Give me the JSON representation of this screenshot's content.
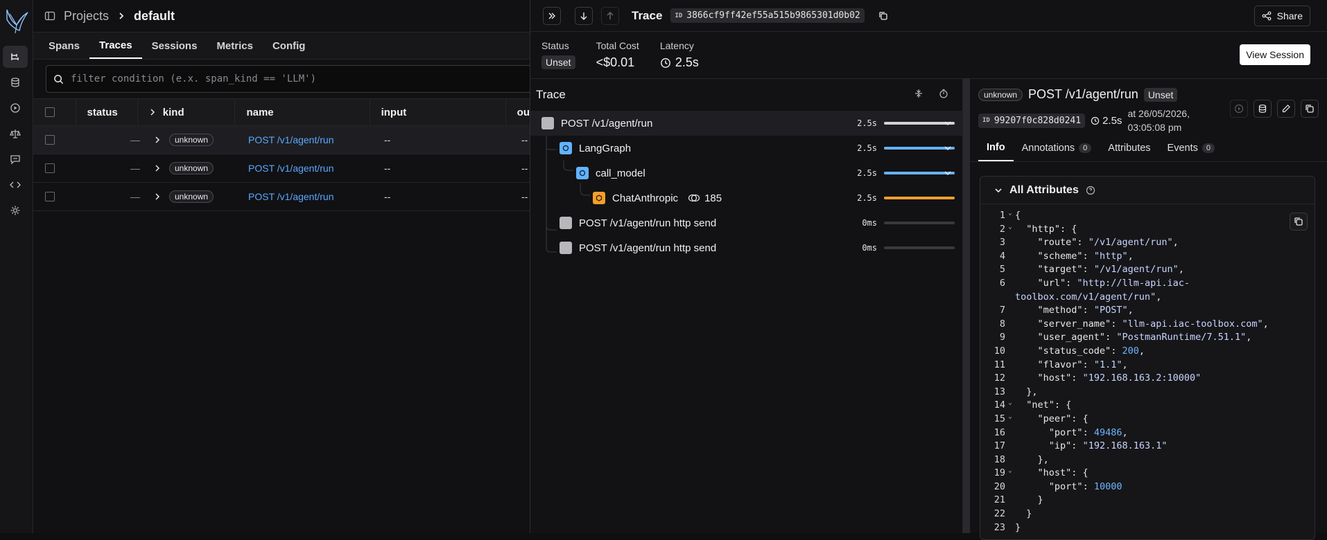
{
  "breadcrumb": {
    "projects": "Projects",
    "current": "default"
  },
  "subtabs": [
    "Spans",
    "Traces",
    "Sessions",
    "Metrics",
    "Config"
  ],
  "active_subtab": "Traces",
  "filter": {
    "placeholder": "filter condition (e.x. span_kind == 'LLM')"
  },
  "table": {
    "headers": [
      "status",
      "kind",
      "name",
      "input",
      "ou"
    ],
    "rows": [
      {
        "status": "—",
        "kind": "unknown",
        "name": "POST /v1/agent/run",
        "input": "--",
        "output": "--"
      },
      {
        "status": "—",
        "kind": "unknown",
        "name": "POST /v1/agent/run",
        "input": "--",
        "output": "--"
      },
      {
        "status": "—",
        "kind": "unknown",
        "name": "POST /v1/agent/run",
        "input": "--",
        "output": "--"
      }
    ]
  },
  "trace": {
    "title": "Trace",
    "id_label": "ID",
    "id": "3866cf9ff42ef55a515b9865301d0b02",
    "share_label": "Share",
    "stats": {
      "status_label": "Status",
      "status": "Unset",
      "cost_label": "Total Cost",
      "cost": "<$0.01",
      "latency_label": "Latency",
      "latency": "2.5s"
    },
    "view_session_label": "View Session",
    "tree_title": "Trace",
    "spans": [
      {
        "name": "POST /v1/agent/run",
        "duration": "2.5s",
        "fraction": 1.0,
        "bar_color": "#d4d4d8",
        "kind": "unknown",
        "depth": 0
      },
      {
        "name": "LangGraph",
        "duration": "2.5s",
        "fraction": 1.0,
        "bar_color": "#63b3ff",
        "kind": "chain",
        "depth": 1
      },
      {
        "name": "call_model",
        "duration": "2.5s",
        "fraction": 1.0,
        "bar_color": "#63b3ff",
        "kind": "chain",
        "depth": 2
      },
      {
        "name": "ChatAnthropic",
        "duration": "2.5s",
        "fraction": 1.0,
        "bar_color": "#f59e2b",
        "kind": "llm",
        "depth": 3,
        "tokens": "185"
      },
      {
        "name": "POST /v1/agent/run http send",
        "duration": "0ms",
        "fraction": 0.0,
        "bar_color": "#d4d4d8",
        "kind": "unknown",
        "depth": 1
      },
      {
        "name": "POST /v1/agent/run http send",
        "duration": "0ms",
        "fraction": 0.0,
        "bar_color": "#d4d4d8",
        "kind": "unknown",
        "depth": 1
      }
    ]
  },
  "span_detail": {
    "kind": "unknown",
    "name": "POST /v1/agent/run",
    "status": "Unset",
    "id_label": "ID",
    "id": "99207f0c828d0241",
    "latency": "2.5s",
    "timestamp": "at 26/05/2026, 03:05:08 pm",
    "tabs": [
      {
        "label": "Info",
        "count": null
      },
      {
        "label": "Annotations",
        "count": "0"
      },
      {
        "label": "Attributes",
        "count": null
      },
      {
        "label": "Events",
        "count": "0"
      }
    ],
    "attributes_title": "All Attributes"
  },
  "code_lines": [
    {
      "n": "1",
      "fold": true,
      "html": "{"
    },
    {
      "n": "2",
      "fold": true,
      "html": "  <span class='k'>\"http\"</span>: {"
    },
    {
      "n": "3",
      "fold": false,
      "html": "    <span class='k'>\"route\"</span>: <span class='s'>\"/v1/agent/run\"</span>,"
    },
    {
      "n": "4",
      "fold": false,
      "html": "    <span class='k'>\"scheme\"</span>: <span class='s'>\"http\"</span>,"
    },
    {
      "n": "5",
      "fold": false,
      "html": "    <span class='k'>\"target\"</span>: <span class='s'>\"/v1/agent/run\"</span>,"
    },
    {
      "n": "6",
      "fold": false,
      "html": "    <span class='k'>\"url\"</span>: <span class='s'>\"http://llm-api.iac-</span>"
    },
    {
      "n": "",
      "fold": false,
      "html": "<span class='s'>toolbox.com/v1/agent/run\"</span>,"
    },
    {
      "n": "7",
      "fold": false,
      "html": "    <span class='k'>\"method\"</span>: <span class='s'>\"POST\"</span>,"
    },
    {
      "n": "8",
      "fold": false,
      "html": "    <span class='k'>\"server_name\"</span>: <span class='s'>\"llm-api.iac-toolbox.com\"</span>,"
    },
    {
      "n": "9",
      "fold": false,
      "html": "    <span class='k'>\"user_agent\"</span>: <span class='s'>\"PostmanRuntime/7.51.1\"</span>,"
    },
    {
      "n": "10",
      "fold": false,
      "html": "    <span class='k'>\"status_code\"</span>: <span class='n'>200</span>,"
    },
    {
      "n": "11",
      "fold": false,
      "html": "    <span class='k'>\"flavor\"</span>: <span class='s'>\"1.1\"</span>,"
    },
    {
      "n": "12",
      "fold": false,
      "html": "    <span class='k'>\"host\"</span>: <span class='s'>\"192.168.163.2:10000\"</span>"
    },
    {
      "n": "13",
      "fold": false,
      "html": "  },"
    },
    {
      "n": "14",
      "fold": true,
      "html": "  <span class='k'>\"net\"</span>: {"
    },
    {
      "n": "15",
      "fold": true,
      "html": "    <span class='k'>\"peer\"</span>: {"
    },
    {
      "n": "16",
      "fold": false,
      "html": "      <span class='k'>\"port\"</span>: <span class='n'>49486</span>,"
    },
    {
      "n": "17",
      "fold": false,
      "html": "      <span class='k'>\"ip\"</span>: <span class='s'>\"192.168.163.1\"</span>"
    },
    {
      "n": "18",
      "fold": false,
      "html": "    },"
    },
    {
      "n": "19",
      "fold": true,
      "html": "    <span class='k'>\"host\"</span>: {"
    },
    {
      "n": "20",
      "fold": false,
      "html": "      <span class='k'>\"port\"</span>: <span class='n'>10000</span>"
    },
    {
      "n": "21",
      "fold": false,
      "html": "    }"
    },
    {
      "n": "22",
      "fold": false,
      "html": "  }"
    },
    {
      "n": "23",
      "fold": false,
      "html": "}"
    }
  ],
  "colors": {
    "link": "#5aa7ff",
    "chain": "#63b3ff",
    "llm": "#f59e2b",
    "unknown": "#b8b8bc"
  }
}
